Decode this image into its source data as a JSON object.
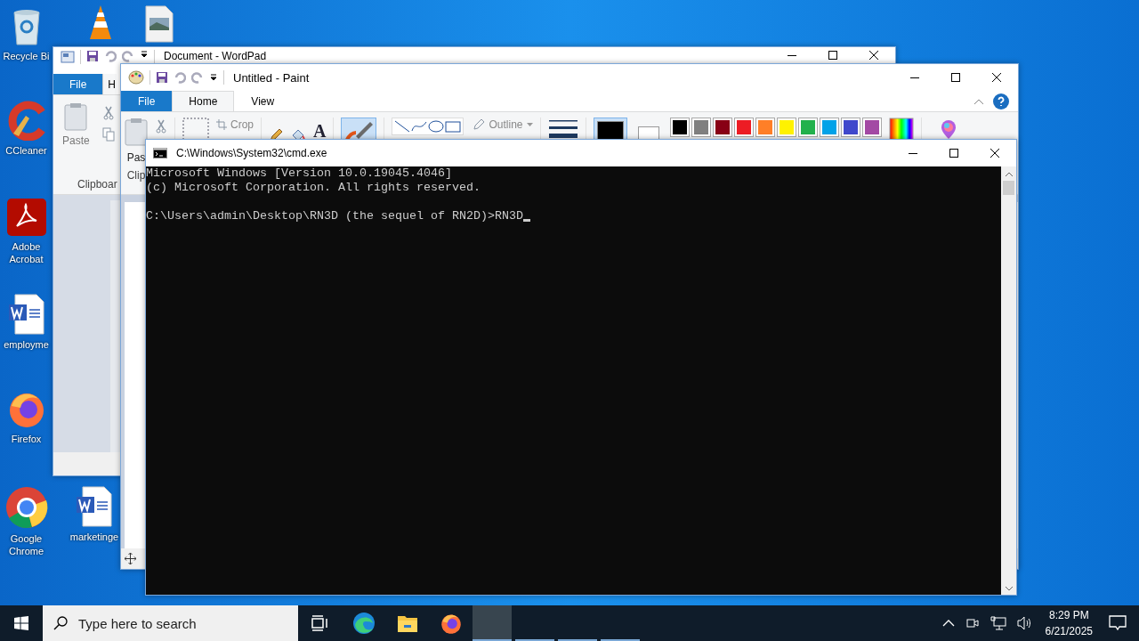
{
  "desktop_icons": [
    {
      "kind": "recycle_bin",
      "label": "Recycle Bi"
    },
    {
      "kind": "vlc"
    },
    {
      "kind": "image_file"
    },
    {
      "kind": "ccleaner",
      "label": "CCleaner"
    },
    {
      "kind": "acrobat",
      "label": "Adobe Acrobat"
    },
    {
      "kind": "word_doc",
      "label": "employme"
    },
    {
      "kind": "firefox",
      "label": "Firefox"
    },
    {
      "kind": "chrome",
      "label": "Google Chrome"
    },
    {
      "kind": "word_doc",
      "label": "marketinge"
    }
  ],
  "wordpad": {
    "title": "Document - WordPad",
    "tabs": [
      {
        "kind": "file",
        "label": "File",
        "selected": false
      },
      {
        "kind": "plain",
        "label": "H",
        "selected": true
      }
    ],
    "paste_label": "Paste",
    "group_label": "Clipboar"
  },
  "paint": {
    "title": "Untitled - Paint",
    "tabs": [
      {
        "kind": "file",
        "label": "File",
        "selected": false
      },
      {
        "kind": "plain",
        "label": "Home",
        "selected": true
      },
      {
        "kind": "plain",
        "label": "View",
        "selected": false
      }
    ],
    "crop_label": "Crop",
    "text_tool": "A",
    "brushes_selected": true,
    "outline_label": "Outline",
    "color1": {
      "color": "#000000",
      "selected": true
    },
    "color2": {
      "color": "#ffffff",
      "selected": false
    },
    "palette": [
      {
        "color": "#000000"
      },
      {
        "color": "#7f7f7f"
      },
      {
        "color": "#880015"
      },
      {
        "color": "#ed1c24"
      },
      {
        "color": "#ff7f27"
      },
      {
        "color": "#fff200"
      },
      {
        "color": "#22b14c"
      },
      {
        "color": "#00a2e8"
      },
      {
        "color": "#3f48cc"
      },
      {
        "color": "#a349a4"
      }
    ],
    "paste_label": "Pas",
    "group_label": "Clip"
  },
  "cmd": {
    "title": "C:\\Windows\\System32\\cmd.exe",
    "output_lines": [
      "Microsoft Windows [Version 10.0.19045.4046]",
      "(c) Microsoft Corporation. All rights reserved."
    ],
    "prompt": "C:\\Users\\admin\\Desktop\\RN3D (the sequel of RN2D)>",
    "input": "RN3D"
  },
  "taskbar": {
    "search_placeholder": "Type here to search",
    "pinned": [
      {
        "kind": "task_view"
      },
      {
        "kind": "edge"
      },
      {
        "kind": "explorer"
      },
      {
        "kind": "firefox"
      }
    ],
    "running": [
      {
        "selected": true
      },
      {
        "selected": false
      },
      {
        "selected": false
      },
      {
        "selected": false
      }
    ],
    "time": "8:29 PM",
    "date": "6/21/2025"
  }
}
